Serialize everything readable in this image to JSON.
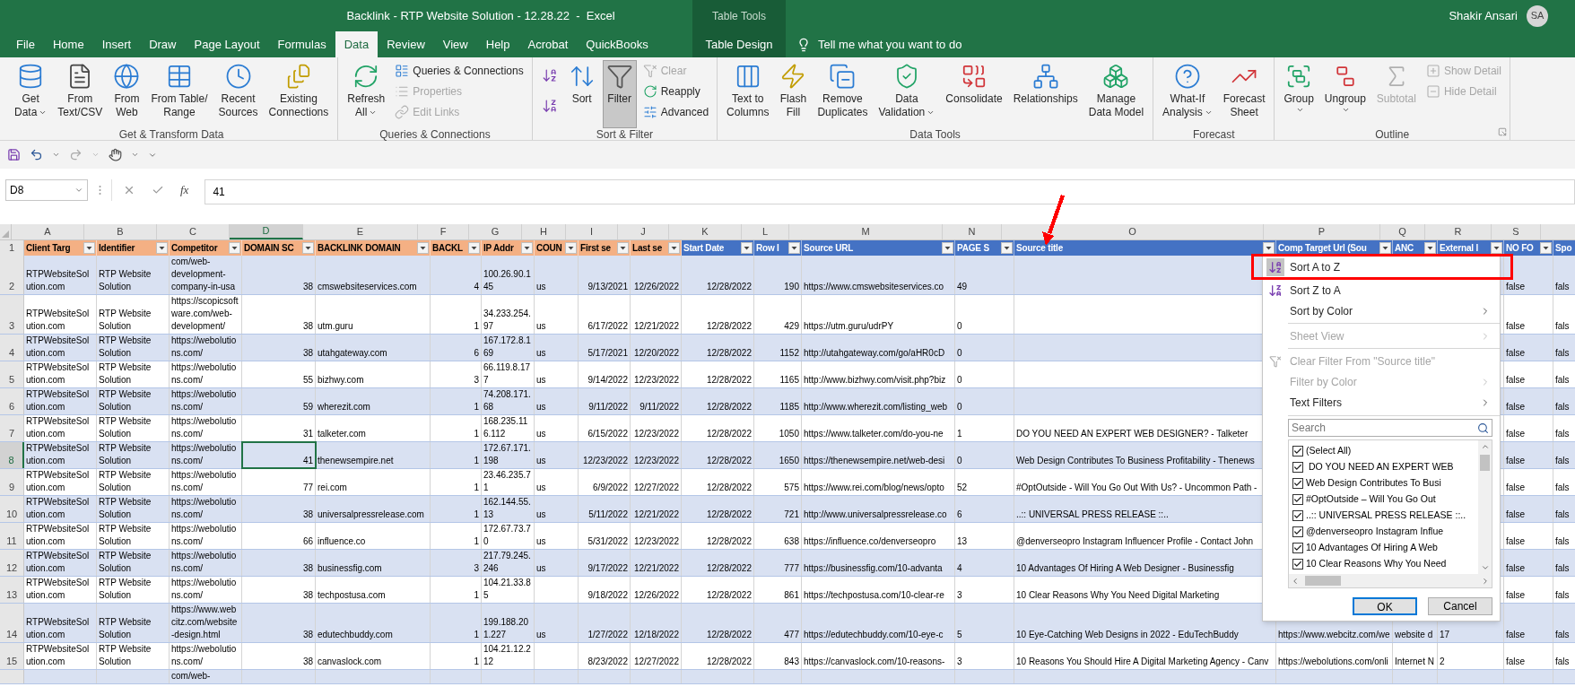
{
  "title_bar": {
    "title": "Backlink - RTP Website Solution - 12.28.22  -  Excel",
    "context_label": "Table Tools",
    "user_name": "Shakir Ansari",
    "user_initials": "SA"
  },
  "tabs": [
    {
      "label": "File",
      "kind": "standard",
      "selected": false
    },
    {
      "label": "Home",
      "kind": "standard",
      "selected": false
    },
    {
      "label": "Insert",
      "kind": "standard",
      "selected": false
    },
    {
      "label": "Draw",
      "kind": "standard",
      "selected": false
    },
    {
      "label": "Page Layout",
      "kind": "standard",
      "selected": false
    },
    {
      "label": "Formulas",
      "kind": "standard",
      "selected": false
    },
    {
      "label": "Data",
      "kind": "standard",
      "selected": true
    },
    {
      "label": "Review",
      "kind": "standard",
      "selected": false
    },
    {
      "label": "View",
      "kind": "standard",
      "selected": false
    },
    {
      "label": "Help",
      "kind": "standard",
      "selected": false
    },
    {
      "label": "Acrobat",
      "kind": "standard",
      "selected": false
    },
    {
      "label": "QuickBooks",
      "kind": "standard",
      "selected": false
    },
    {
      "label": "Table Design",
      "kind": "contextual",
      "selected": false
    }
  ],
  "tell_me": "Tell me what you want to do",
  "ribbon": [
    {
      "label": "Get & Transform Data",
      "columns": [
        [
          {
            "kind": "large",
            "lines": [
              "Get",
              "Data"
            ],
            "dropdown": true,
            "disabled": false,
            "pressed": false
          }
        ],
        [
          {
            "kind": "large",
            "lines": [
              "From",
              "Text/CSV"
            ],
            "dropdown": false,
            "disabled": false,
            "pressed": false
          }
        ],
        [
          {
            "kind": "large",
            "lines": [
              "From",
              "Web"
            ],
            "dropdown": false,
            "disabled": false,
            "pressed": false
          }
        ],
        [
          {
            "kind": "large",
            "lines": [
              "From Table/",
              "Range"
            ],
            "dropdown": false,
            "disabled": false,
            "pressed": false
          }
        ],
        [
          {
            "kind": "large",
            "lines": [
              "Recent",
              "Sources"
            ],
            "dropdown": false,
            "disabled": false,
            "pressed": false
          }
        ],
        [
          {
            "kind": "large",
            "lines": [
              "Existing",
              "Connections"
            ],
            "dropdown": false,
            "disabled": false,
            "pressed": false
          }
        ]
      ]
    },
    {
      "label": "Queries & Connections",
      "columns": [
        [
          {
            "kind": "large",
            "lines": [
              "Refresh",
              "All"
            ],
            "dropdown": true,
            "disabled": false,
            "pressed": false
          }
        ],
        [
          {
            "kind": "small",
            "lines": [
              "Queries & Connections"
            ],
            "dropdown": false,
            "disabled": false,
            "pressed": false
          },
          {
            "kind": "small",
            "lines": [
              "Properties"
            ],
            "dropdown": false,
            "disabled": true,
            "pressed": false
          },
          {
            "kind": "small",
            "lines": [
              "Edit Links"
            ],
            "dropdown": false,
            "disabled": true,
            "pressed": false
          }
        ]
      ]
    },
    {
      "label": "Sort & Filter",
      "columns": [
        [
          {
            "kind": "icon",
            "dropdown": false,
            "disabled": false,
            "pressed": false
          },
          {
            "kind": "icon",
            "dropdown": false,
            "disabled": false,
            "pressed": false
          }
        ],
        [
          {
            "kind": "large",
            "lines": [
              "Sort"
            ],
            "dropdown": false,
            "disabled": false,
            "pressed": false
          }
        ],
        [
          {
            "kind": "large",
            "lines": [
              "Filter"
            ],
            "dropdown": false,
            "disabled": false,
            "pressed": true
          }
        ],
        [
          {
            "kind": "small",
            "lines": [
              "Clear"
            ],
            "dropdown": false,
            "disabled": true,
            "pressed": false
          },
          {
            "kind": "small",
            "lines": [
              "Reapply"
            ],
            "dropdown": false,
            "disabled": false,
            "pressed": false
          },
          {
            "kind": "small",
            "lines": [
              "Advanced"
            ],
            "dropdown": false,
            "disabled": false,
            "pressed": false
          }
        ]
      ]
    },
    {
      "label": "Data Tools",
      "columns": [
        [
          {
            "kind": "large",
            "lines": [
              "Text to",
              "Columns"
            ],
            "dropdown": false,
            "disabled": false,
            "pressed": false
          }
        ],
        [
          {
            "kind": "large",
            "lines": [
              "Flash",
              "Fill"
            ],
            "dropdown": false,
            "disabled": false,
            "pressed": false
          }
        ],
        [
          {
            "kind": "large",
            "lines": [
              "Remove",
              "Duplicates"
            ],
            "dropdown": false,
            "disabled": false,
            "pressed": false
          }
        ],
        [
          {
            "kind": "large",
            "lines": [
              "Data",
              "Validation"
            ],
            "dropdown": true,
            "disabled": false,
            "pressed": false
          }
        ],
        [
          {
            "kind": "large",
            "lines": [
              "Consolidate"
            ],
            "dropdown": false,
            "disabled": false,
            "pressed": false
          }
        ],
        [
          {
            "kind": "large",
            "lines": [
              "Relationships"
            ],
            "dropdown": false,
            "disabled": false,
            "pressed": false
          }
        ],
        [
          {
            "kind": "large",
            "lines": [
              "Manage",
              "Data Model"
            ],
            "dropdown": false,
            "disabled": false,
            "pressed": false
          }
        ]
      ]
    },
    {
      "label": "Forecast",
      "columns": [
        [
          {
            "kind": "large",
            "lines": [
              "What-If",
              "Analysis"
            ],
            "dropdown": true,
            "disabled": false,
            "pressed": false
          }
        ],
        [
          {
            "kind": "large",
            "lines": [
              "Forecast",
              "Sheet"
            ],
            "dropdown": false,
            "disabled": false,
            "pressed": false
          }
        ]
      ]
    },
    {
      "label": "Outline",
      "columns": [
        [
          {
            "kind": "large",
            "lines": [
              "Group"
            ],
            "dropdown": true,
            "disabled": false,
            "pressed": false
          }
        ],
        [
          {
            "kind": "large",
            "lines": [
              "Ungroup"
            ],
            "dropdown": true,
            "disabled": false,
            "pressed": false
          }
        ],
        [
          {
            "kind": "large",
            "lines": [
              "Subtotal"
            ],
            "dropdown": false,
            "disabled": true,
            "pressed": false
          }
        ],
        [
          {
            "kind": "small",
            "lines": [
              "Show Detail"
            ],
            "dropdown": false,
            "disabled": true,
            "pressed": false
          },
          {
            "kind": "small",
            "lines": [
              "Hide Detail"
            ],
            "dropdown": false,
            "disabled": true,
            "pressed": false
          }
        ]
      ]
    }
  ],
  "formula_bar": {
    "name_box": "D8",
    "function_label": "fx",
    "formula": "41"
  },
  "columns": [
    {
      "letter": "A",
      "header": "Client Targ",
      "color": "#f4b084",
      "selected": false
    },
    {
      "letter": "B",
      "header": "Identifier",
      "color": "#f4b084",
      "selected": false
    },
    {
      "letter": "C",
      "header": "Competitor",
      "color": "#f4b084",
      "selected": false
    },
    {
      "letter": "D",
      "header": "DOMAIN SC",
      "color": "#f4b084",
      "selected": true
    },
    {
      "letter": "E",
      "header": "BACKLINK DOMAIN",
      "color": "#f4b084",
      "selected": false
    },
    {
      "letter": "F",
      "header": "BACKL",
      "color": "#f4b084",
      "selected": false
    },
    {
      "letter": "G",
      "header": "IP Addr",
      "color": "#f4b084",
      "selected": false
    },
    {
      "letter": "H",
      "header": "COUN",
      "color": "#f4b084",
      "selected": false
    },
    {
      "letter": "I",
      "header": "First se",
      "color": "#f4b084",
      "selected": false
    },
    {
      "letter": "J",
      "header": "Last se",
      "color": "#f4b084",
      "selected": false
    },
    {
      "letter": "K",
      "header": "Start Date",
      "color": "#4472c4",
      "selected": false
    },
    {
      "letter": "L",
      "header": "Row I",
      "color": "#4472c4",
      "selected": false
    },
    {
      "letter": "M",
      "header": "Source URL",
      "color": "#4472c4",
      "selected": false
    },
    {
      "letter": "N",
      "header": "PAGE S",
      "color": "#4472c4",
      "selected": false
    },
    {
      "letter": "O",
      "header": "Source title",
      "color": "#4472c4",
      "selected": false
    },
    {
      "letter": "P",
      "header": "Comp Target Url (Sou",
      "color": "#4472c4",
      "selected": false
    },
    {
      "letter": "Q",
      "header": "ANC",
      "color": "#4472c4",
      "selected": false
    },
    {
      "letter": "R",
      "header": "External l",
      "color": "#4472c4",
      "selected": false
    },
    {
      "letter": "S",
      "header": "NO FO",
      "color": "#4472c4",
      "selected": false
    },
    {
      "header": "Spo",
      "color": "#4472c4",
      "selected": false
    }
  ],
  "header_row_number": "1",
  "rows": [
    {
      "number": "2",
      "selected": false,
      "cells": {
        "A": "RTPWebsiteSolution.com",
        "B": "RTP Website Solution",
        "C": "com/web-development-company-in-usa",
        "D": "38",
        "E": "cmswebsiteservices.com",
        "F": "4",
        "G": "100.26.90.145",
        "H": "us",
        "I": "9/13/2021",
        "J": "12/26/2022",
        "K": "12/28/2022",
        "L": "190",
        "M": "https://www.cmswebsiteservices.co",
        "N": "49",
        "S": "false",
        "T": "fals"
      }
    },
    {
      "number": "3",
      "selected": false,
      "cells": {
        "A": "RTPWebsiteSolution.com",
        "B": "RTP Website Solution",
        "C": "https://scopicsoftware.com/web-development/",
        "D": "38",
        "E": "utm.guru",
        "F": "1",
        "G": "34.233.254.97",
        "H": "us",
        "I": "6/17/2022",
        "J": "12/21/2022",
        "K": "12/28/2022",
        "L": "429",
        "M": "https://utm.guru/udrPY",
        "N": "0",
        "S": "false",
        "T": "fals"
      }
    },
    {
      "number": "4",
      "selected": false,
      "cells": {
        "A": "RTPWebsiteSolution.com",
        "B": "RTP Website Solution",
        "C": "https://webolutions.com/",
        "D": "38",
        "E": "utahgateway.com",
        "F": "6",
        "G": "167.172.8.169",
        "H": "us",
        "I": "5/17/2021",
        "J": "12/20/2022",
        "K": "12/28/2022",
        "L": "1152",
        "M": "http://utahgateway.com/go/aHR0cD",
        "N": "0",
        "S": "false",
        "T": "fals"
      }
    },
    {
      "number": "5",
      "selected": false,
      "cells": {
        "A": "RTPWebsiteSolution.com",
        "B": "RTP Website Solution",
        "C": "https://webolutions.com/",
        "D": "55",
        "E": "bizhwy.com",
        "F": "3",
        "G": "66.119.8.177",
        "H": "us",
        "I": "9/14/2022",
        "J": "12/23/2022",
        "K": "12/28/2022",
        "L": "1165",
        "M": "http://www.bizhwy.com/visit.php?biz",
        "N": "0",
        "S": "false",
        "T": "fals"
      }
    },
    {
      "number": "6",
      "selected": false,
      "cells": {
        "A": "RTPWebsiteSolution.com",
        "B": "RTP Website Solution",
        "C": "https://webolutions.com/",
        "D": "59",
        "E": "wherezit.com",
        "F": "1",
        "G": "74.208.171.68",
        "H": "us",
        "I": "9/11/2022",
        "J": "9/11/2022",
        "K": "12/28/2022",
        "L": "1185",
        "M": "http://www.wherezit.com/listing_web",
        "N": "0",
        "S": "false",
        "T": "fals"
      }
    },
    {
      "number": "7",
      "selected": false,
      "cells": {
        "A": "RTPWebsiteSolution.com",
        "B": "RTP Website Solution",
        "C": "https://webolutions.com/",
        "D": "31",
        "E": "talketer.com",
        "F": "1",
        "G": "168.235.116.112",
        "H": "us",
        "I": "6/15/2022",
        "J": "12/23/2022",
        "K": "12/28/2022",
        "L": "1050",
        "M": "https://www.talketer.com/do-you-ne",
        "N": "1",
        "O": "DO YOU NEED AN EXPERT WEB DESIGNER? - Talketer",
        "S": "false",
        "T": "fals"
      }
    },
    {
      "number": "8",
      "selected": true,
      "cells": {
        "A": "RTPWebsiteSolution.com",
        "B": "RTP Website Solution",
        "C": "https://webolutions.com/",
        "D": "41",
        "E": "thenewsempire.net",
        "F": "1",
        "G": "172.67.171.198",
        "H": "us",
        "I": "12/23/2022",
        "J": "12/23/2022",
        "K": "12/28/2022",
        "L": "1650",
        "M": "https://thenewsempire.net/web-desi",
        "N": "0",
        "O": "Web Design Contributes To Business Profitability - Thenews",
        "S": "false",
        "T": "fals"
      }
    },
    {
      "number": "9",
      "selected": false,
      "cells": {
        "A": "RTPWebsiteSolution.com",
        "B": "RTP Website Solution",
        "C": "https://webolutions.com/",
        "D": "77",
        "E": "rei.com",
        "F": "1",
        "G": "23.46.235.71",
        "H": "us",
        "I": "6/9/2022",
        "J": "12/27/2022",
        "K": "12/28/2022",
        "L": "575",
        "M": "https://www.rei.com/blog/news/opto",
        "N": "52",
        "O": "#OptOutside - Will You Go Out With Us? - Uncommon Path -",
        "S": "false",
        "T": "fals"
      }
    },
    {
      "number": "10",
      "selected": false,
      "cells": {
        "A": "RTPWebsiteSolution.com",
        "B": "RTP Website Solution",
        "C": "https://webolutions.com/",
        "D": "38",
        "E": "universalpressrelease.com",
        "F": "1",
        "G": "162.144.55.13",
        "H": "us",
        "I": "5/11/2022",
        "J": "12/21/2022",
        "K": "12/28/2022",
        "L": "721",
        "M": "http://www.universalpressrelease.co",
        "N": "6",
        "O": "..:: UNIVERSAL PRESS RELEASE ::..",
        "S": "false",
        "T": "fals"
      }
    },
    {
      "number": "11",
      "selected": false,
      "cells": {
        "A": "RTPWebsiteSolution.com",
        "B": "RTP Website Solution",
        "C": "https://webolutions.com/",
        "D": "66",
        "E": "influence.co",
        "F": "1",
        "G": "172.67.73.70",
        "H": "us",
        "I": "5/31/2022",
        "J": "12/23/2022",
        "K": "12/28/2022",
        "L": "638",
        "M": "https://influence.co/denverseopro",
        "N": "13",
        "O": "@denverseopro Instagram Influencer Profile - Contact John",
        "S": "false",
        "T": "fals"
      }
    },
    {
      "number": "12",
      "selected": false,
      "cells": {
        "A": "RTPWebsiteSolution.com",
        "B": "RTP Website Solution",
        "C": "https://webolutions.com/",
        "D": "38",
        "E": "businessfig.com",
        "F": "3",
        "G": "217.79.245.246",
        "H": "us",
        "I": "9/17/2022",
        "J": "12/21/2022",
        "K": "12/28/2022",
        "L": "777",
        "M": "https://businessfig.com/10-advanta",
        "N": "4",
        "O": "10 Advantages Of Hiring A Web Designer - Businessfig",
        "S": "false",
        "T": "fals"
      }
    },
    {
      "number": "13",
      "selected": false,
      "cells": {
        "A": "RTPWebsiteSolution.com",
        "B": "RTP Website Solution",
        "C": "https://webolutions.com/",
        "D": "38",
        "E": "techpostusa.com",
        "F": "1",
        "G": "104.21.33.85",
        "I": "9/18/2022",
        "J": "12/26/2022",
        "K": "12/28/2022",
        "L": "861",
        "M": "https://techpostusa.com/10-clear-re",
        "N": "3",
        "O": "10 Clear Reasons Why You Need Digital Marketing",
        "S": "false",
        "T": "fals"
      }
    },
    {
      "number": "14",
      "selected": false,
      "cells": {
        "A": "RTPWebsiteSolution.com",
        "B": "RTP Website Solution",
        "C": "https://www.webcitz.com/website-design.html",
        "D": "38",
        "E": "edutechbuddy.com",
        "F": "1",
        "G": "199.188.201.227",
        "H": "us",
        "I": "1/27/2022",
        "J": "12/18/2022",
        "K": "12/28/2022",
        "L": "477",
        "M": "https://edutechbuddy.com/10-eye-c",
        "N": "5",
        "O": "10 Eye-Catching Web Designs in 2022 - EduTechBuddy",
        "P": "https://www.webcitz.com/we",
        "Q": "website d",
        "R": "17",
        "S": "false",
        "T": "fals"
      }
    },
    {
      "number": "15",
      "selected": false,
      "cells": {
        "A": "RTPWebsiteSolution.com",
        "B": "RTP Website Solution",
        "C": "https://webolutions.com/",
        "D": "38",
        "E": "canvaslock.com",
        "F": "1",
        "G": "104.21.12.212",
        "I": "8/23/2022",
        "J": "12/27/2022",
        "K": "12/28/2022",
        "L": "843",
        "M": "https://canvaslock.com/10-reasons-",
        "N": "3",
        "O": "10 Reasons You Should Hire A Digital Marketing Agency - Canv",
        "P": "https://webolutions.com/onli",
        "Q": "Internet N",
        "R": "2",
        "S": "false",
        "T": "fals"
      }
    },
    {
      "selected": false,
      "cells": {
        "C": "com/web-"
      }
    }
  ],
  "filter_menu": {
    "items": [
      {
        "kind": "sort",
        "label": "Sort A to Z",
        "disabled": false,
        "submenu": false,
        "highlighted": true
      },
      {
        "kind": "sort",
        "label": "Sort Z to A",
        "disabled": false,
        "submenu": false,
        "highlighted": false
      },
      {
        "kind": "sort",
        "label": "Sort by Color",
        "disabled": false,
        "submenu": true,
        "highlighted": false
      },
      {
        "kind": "view",
        "label": "Sheet View",
        "disabled": true,
        "submenu": true,
        "highlighted": false
      },
      {
        "kind": "filter",
        "label": "Clear Filter From \"Source title\"",
        "disabled": true,
        "submenu": false,
        "highlighted": false
      },
      {
        "kind": "filter",
        "label": "Filter by Color",
        "disabled": true,
        "submenu": true,
        "highlighted": false
      },
      {
        "kind": "filter",
        "label": "Text Filters",
        "disabled": false,
        "submenu": true,
        "highlighted": false
      }
    ],
    "search": {
      "placeholder": "Search"
    },
    "values": [
      {
        "label": "(Select All)",
        "checked": true
      },
      {
        "label": " DO YOU NEED AN EXPERT WEB",
        "checked": true
      },
      {
        "label": "Web Design Contributes To Busi",
        "checked": true
      },
      {
        "label": "#OptOutside – Will You Go Out",
        "checked": true
      },
      {
        "label": "..:: UNIVERSAL PRESS RELEASE ::..",
        "checked": true
      },
      {
        "label": "@denverseopro Instagram Influe",
        "checked": true
      },
      {
        "label": "10 Advantages Of Hiring A Web",
        "checked": true
      },
      {
        "label": "10 Clear Reasons Why You Need",
        "checked": true
      }
    ],
    "buttons": [
      {
        "label": "OK",
        "kind": "primary"
      },
      {
        "label": "Cancel",
        "kind": "secondary"
      }
    ]
  },
  "annotations": {
    "pointer_arrow": {
      "color": "#ff0000"
    },
    "highlight_box": {
      "color": "#ff0000"
    }
  }
}
